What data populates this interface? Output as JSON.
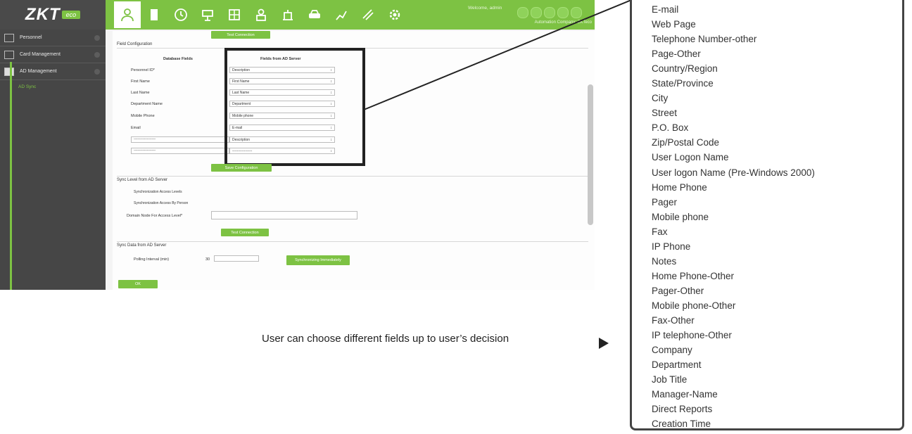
{
  "app": {
    "logo_text": "ZKT",
    "logo_sub": "eco",
    "welcome": "Welcome, admin",
    "company": "Automation Company: ZKTeco",
    "nav_icons": [
      "person-icon",
      "door-icon",
      "clock-icon",
      "elevator-icon",
      "hotel-icon",
      "visitor-icon",
      "park-icon",
      "car-icon",
      "report-icon",
      "pass-icon",
      "gear-icon"
    ],
    "sidebar": {
      "items": [
        {
          "label": "Personnel"
        },
        {
          "label": "Card Management"
        },
        {
          "label": "AD Management"
        }
      ],
      "sub_item": "AD Sync"
    },
    "test_connection": "Test Connection",
    "field_config_title": "Field Configuration",
    "col_db": "Database Fields",
    "col_ad": "Fields from AD Server",
    "rows": [
      {
        "label": "Personnel ID*",
        "value": "Description"
      },
      {
        "label": "First Name",
        "value": "First Name"
      },
      {
        "label": "Last Name",
        "value": "Last Name"
      },
      {
        "label": "Department Name",
        "value": "Department"
      },
      {
        "label": "Mobile Phone",
        "value": "Mobile phone"
      },
      {
        "label": "Email",
        "value": "E-mail"
      },
      {
        "label": "-----------------",
        "value": "Description"
      },
      {
        "label": "-----------------",
        "value": "-----------------"
      }
    ],
    "save_config": "Save Configuration",
    "sync_level_title": "Sync Level from AD Server",
    "sync_access": "Synchronization Access Levels",
    "sync_person": "Synchronization Access By Person",
    "domain_label": "Domain Node For Access Level*",
    "test_connection2": "Test Connection",
    "sync_data_title": "Sync Data from AD Server",
    "polling_label": "Polling Interval (min)",
    "polling_value": "30",
    "sync_now": "Synchronizing Immediately",
    "ok": "OK"
  },
  "annotation": {
    "text": "User can choose different fields up to user’s decision"
  },
  "dropdown": {
    "options": [
      "E-mail",
      "Web Page",
      "Telephone Number-other",
      "Page-Other",
      "Country/Region",
      "State/Province",
      "City",
      "Street",
      "P.O. Box",
      "Zip/Postal Code",
      "User Logon Name",
      "User logon Name (Pre-Windows 2000)",
      "Home Phone",
      "Pager",
      "Mobile phone",
      "Fax",
      "IP Phone",
      "Notes",
      "Home Phone-Other",
      "Pager-Other",
      "Mobile phone-Other",
      "Fax-Other",
      "IP telephone-Other",
      "Company",
      "Department",
      "Job Title",
      "Manager-Name",
      "Direct Reports",
      "Creation Time"
    ]
  },
  "colors": {
    "brand_green": "#7dc243",
    "sidebar_gray": "#464646"
  }
}
